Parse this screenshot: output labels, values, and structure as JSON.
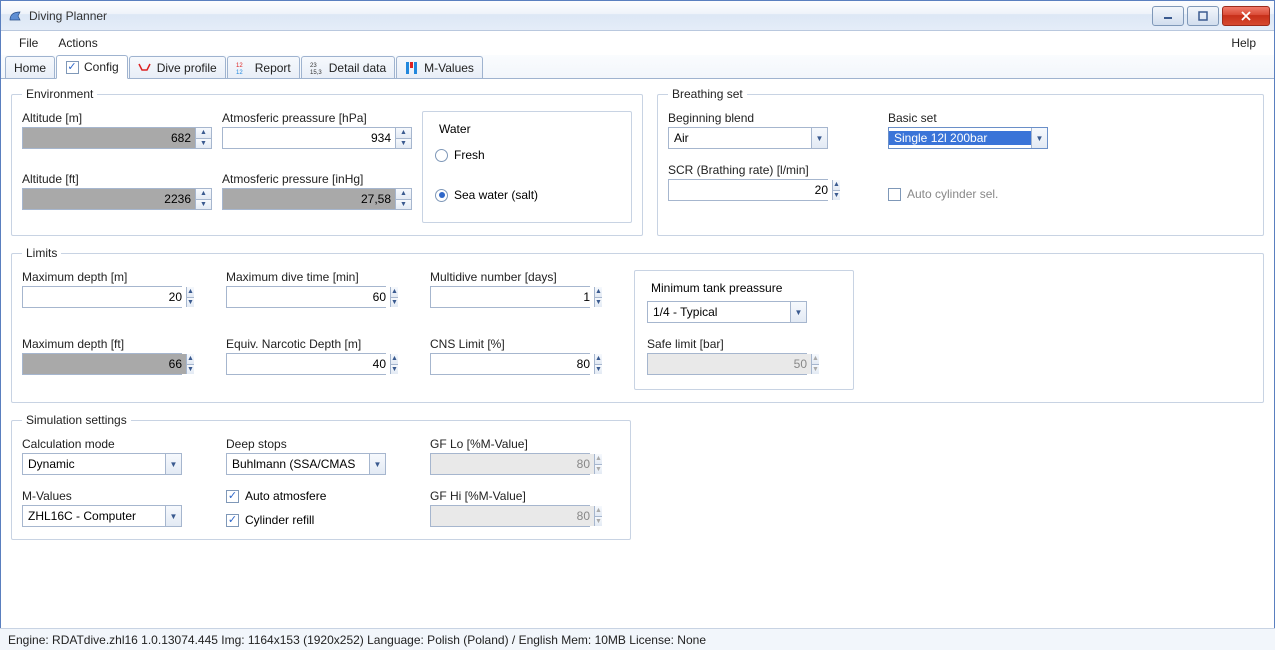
{
  "window": {
    "title": "Diving Planner"
  },
  "menu": {
    "file": "File",
    "actions": "Actions",
    "help": "Help"
  },
  "tabs": {
    "home": "Home",
    "config": "Config",
    "dive_profile": "Dive profile",
    "report": "Report",
    "detail_data": "Detail data",
    "m_values": "M-Values"
  },
  "env": {
    "legend": "Environment",
    "altitude_m_label": "Altitude [m]",
    "altitude_m_value": "682",
    "press_hpa_label": "Atmosferic preassure [hPa]",
    "press_hpa_value": "934",
    "altitude_ft_label": "Altitude [ft]",
    "altitude_ft_value": "2236",
    "press_inhg_label": "Atmosferic pressure [inHg]",
    "press_inhg_value": "27,58",
    "water_legend": "Water",
    "water_fresh": "Fresh",
    "water_salt": "Sea water (salt)"
  },
  "breath": {
    "legend": "Breathing set",
    "begin_blend_label": "Beginning blend",
    "begin_blend_value": "Air",
    "basic_set_label": "Basic set",
    "basic_set_value": "Single 12l 200bar",
    "scr_label": "SCR (Brathing rate) [l/min]",
    "scr_value": "20",
    "auto_cyl_label": "Auto cylinder sel."
  },
  "limits": {
    "legend": "Limits",
    "max_depth_m_label": "Maximum depth [m]",
    "max_depth_m_value": "20",
    "max_time_label": "Maximum dive time [min]",
    "max_time_value": "60",
    "multidive_label": "Multidive number [days]",
    "multidive_value": "1",
    "max_depth_ft_label": "Maximum depth [ft]",
    "max_depth_ft_value": "66",
    "end_label": "Equiv. Narcotic Depth [m]",
    "end_value": "40",
    "cns_label": "CNS Limit [%]",
    "cns_value": "80",
    "min_tank_legend": "Minimum tank preassure",
    "min_tank_value": "1/4 - Typical",
    "safe_limit_label": "Safe limit [bar]",
    "safe_limit_value": "50"
  },
  "sim": {
    "legend": "Simulation settings",
    "calc_mode_label": "Calculation mode",
    "calc_mode_value": "Dynamic",
    "deep_stops_label": "Deep stops",
    "deep_stops_value": "Buhlmann (SSA/CMAS",
    "gf_lo_label": "GF Lo [%M-Value]",
    "gf_lo_value": "80",
    "mvalues_label": "M-Values",
    "mvalues_value": "ZHL16C - Computer",
    "auto_atm_label": "Auto atmosfere",
    "cyl_refill_label": "Cylinder refill",
    "gf_hi_label": "GF Hi [%M-Value]",
    "gf_hi_value": "80"
  },
  "status": {
    "text": "Engine: RDATdive.zhl16 1.0.13074.445   Img: 1164x153 (1920x252)   Language: Polish (Poland) / English   Mem: 10MB   License: None"
  }
}
